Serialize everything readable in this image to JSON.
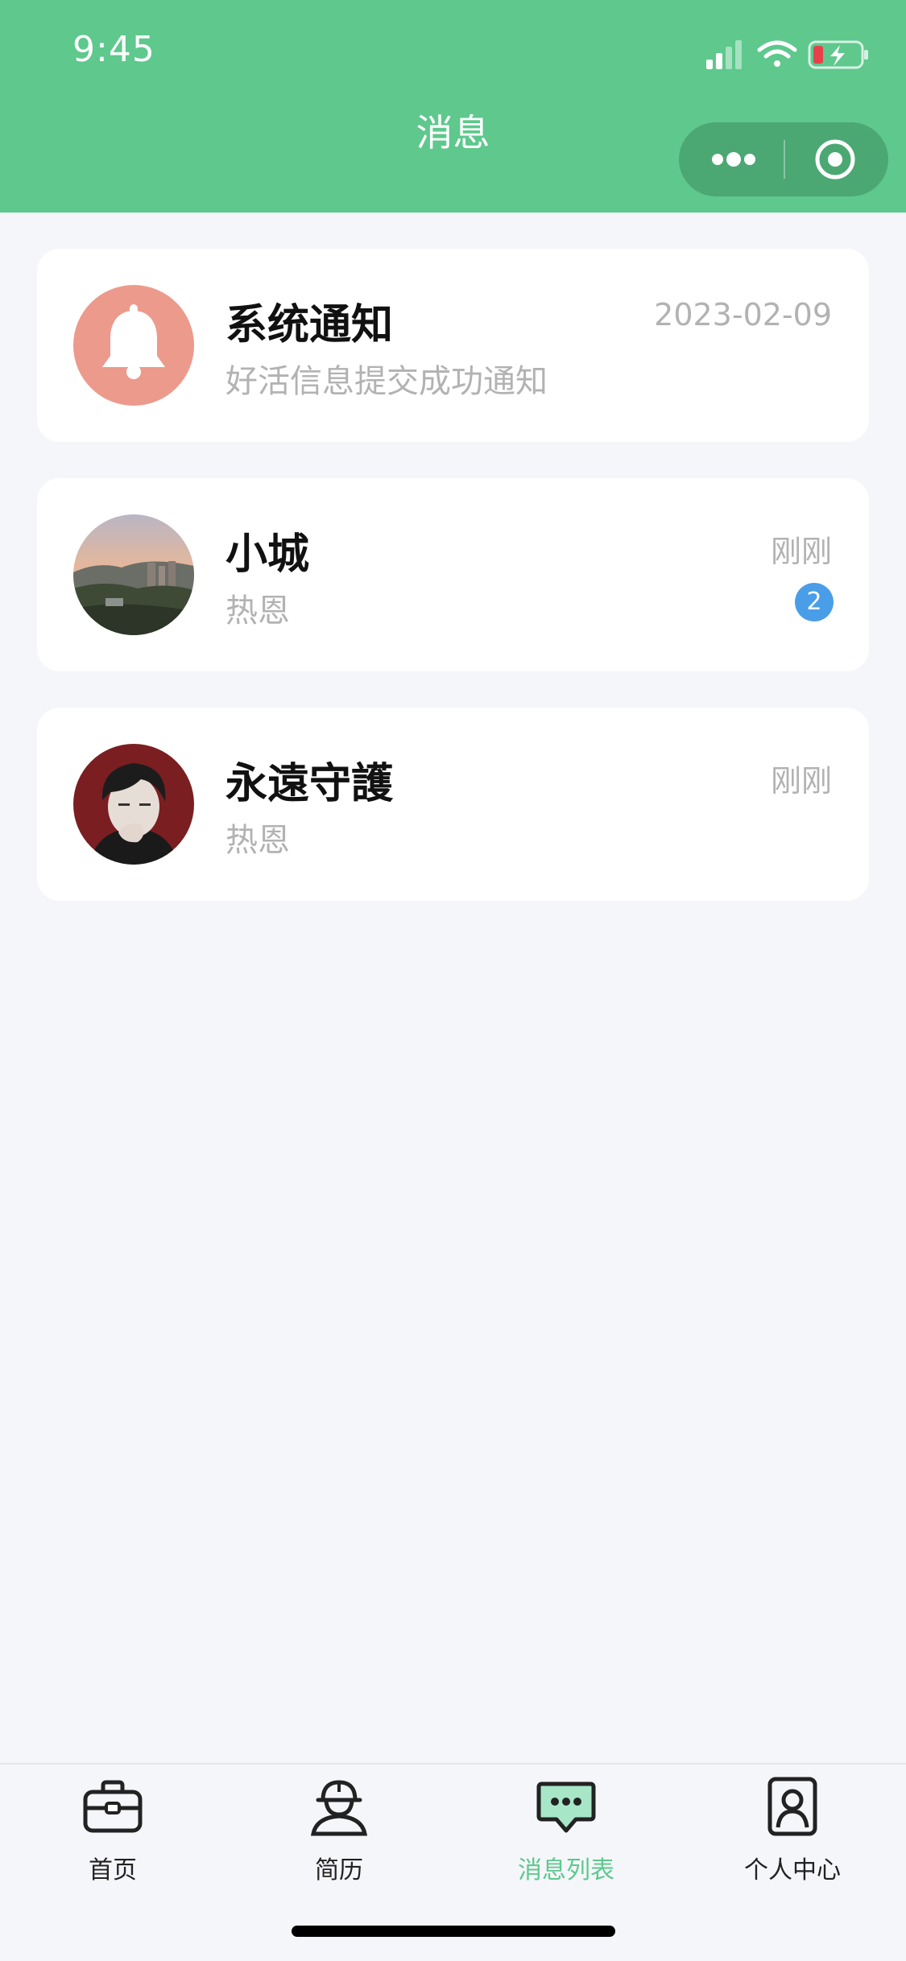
{
  "status_bar": {
    "time": "9:45"
  },
  "header": {
    "title": "消息"
  },
  "messages": [
    {
      "name": "系统通知",
      "subtitle": "好活信息提交成功通知",
      "time": "2023-02-09",
      "avatar": "bell-icon"
    },
    {
      "name": "小城",
      "subtitle": "热恩",
      "time": "刚刚",
      "badge": "2",
      "avatar": "landscape-photo"
    },
    {
      "name": "永遠守護",
      "subtitle": "热恩",
      "time": "刚刚",
      "avatar": "character-portrait"
    }
  ],
  "tabbar": {
    "items": [
      {
        "label": "首页",
        "icon": "briefcase-icon",
        "active": false
      },
      {
        "label": "简历",
        "icon": "worker-helmet-icon",
        "active": false
      },
      {
        "label": "消息列表",
        "icon": "chat-bubble-icon",
        "active": true
      },
      {
        "label": "个人中心",
        "icon": "profile-card-icon",
        "active": false
      }
    ]
  },
  "colors": {
    "brand": "#5ec88d",
    "badge": "#4a9ee8",
    "notify_avatar": "#ec9a8c",
    "background": "#f5f6fa"
  }
}
